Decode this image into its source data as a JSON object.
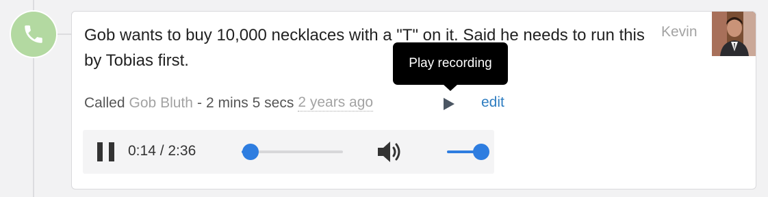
{
  "activity": {
    "type_icon": "phone-icon",
    "badge_color": "#b3d9a1",
    "note": "Gob wants to buy 10,000 necklaces with a \"T\" on it. Said he needs to run this by Tobias first.",
    "author": "Kevin",
    "meta": {
      "action": "Called",
      "contact": "Gob Bluth",
      "separator": "-",
      "duration": "2 mins 5 secs",
      "time_ago": "2 years ago"
    },
    "edit_label": "edit",
    "play_icon": "play-icon",
    "tooltip": "Play recording"
  },
  "player": {
    "state_icon": "pause-icon",
    "time_display": "0:14 / 2:36",
    "progress": 0.0897,
    "volume_icon": "volume-icon",
    "volume": 1.0,
    "accent_color": "#2e7de0"
  },
  "colors": {
    "link": "#2e7dc1",
    "muted": "#a3a3a3",
    "text": "#222222"
  }
}
